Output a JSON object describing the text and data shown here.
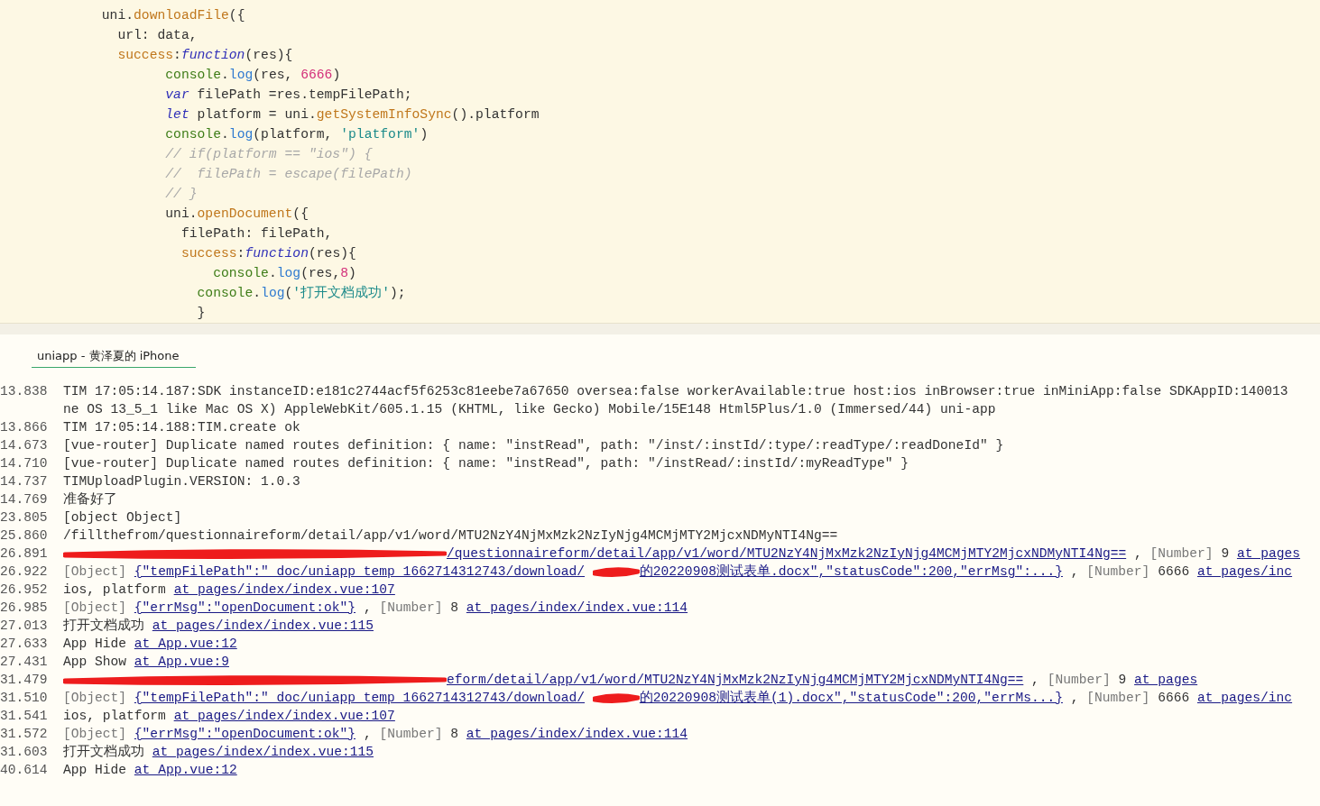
{
  "editor": {
    "lines": [
      [
        {
          "kind": "plain",
          "text": "            uni."
        },
        {
          "kind": "method",
          "text": "downloadFile"
        },
        {
          "kind": "plain",
          "text": "({"
        }
      ],
      [
        {
          "kind": "plain",
          "text": "              url: data,"
        }
      ],
      [
        {
          "kind": "method",
          "text": "              success"
        },
        {
          "kind": "plain",
          "text": ":"
        },
        {
          "kind": "keyword",
          "text": "function"
        },
        {
          "kind": "plain",
          "text": "(res){"
        }
      ],
      [
        {
          "kind": "console",
          "text": "                    console"
        },
        {
          "kind": "plain",
          "text": "."
        },
        {
          "kind": "log",
          "text": "log"
        },
        {
          "kind": "plain",
          "text": "(res, "
        },
        {
          "kind": "number",
          "text": "6666"
        },
        {
          "kind": "plain",
          "text": ")"
        }
      ],
      [
        {
          "kind": "keyword",
          "text": "                    var"
        },
        {
          "kind": "plain",
          "text": " filePath =res.tempFilePath;"
        }
      ],
      [
        {
          "kind": "keyword",
          "text": "                    let"
        },
        {
          "kind": "plain",
          "text": " platform = uni."
        },
        {
          "kind": "method",
          "text": "getSystemInfoSync"
        },
        {
          "kind": "plain",
          "text": "().platform"
        }
      ],
      [
        {
          "kind": "console",
          "text": "                    console"
        },
        {
          "kind": "plain",
          "text": "."
        },
        {
          "kind": "log",
          "text": "log"
        },
        {
          "kind": "plain",
          "text": "(platform, "
        },
        {
          "kind": "string",
          "text": "'platform'"
        },
        {
          "kind": "plain",
          "text": ")"
        }
      ],
      [
        {
          "kind": "comment",
          "text": "                    // if(platform == \"ios\") {"
        }
      ],
      [
        {
          "kind": "comment",
          "text": "                    //  filePath = escape(filePath)"
        }
      ],
      [
        {
          "kind": "comment",
          "text": "                    // }"
        }
      ],
      [
        {
          "kind": "plain",
          "text": "                    uni."
        },
        {
          "kind": "method",
          "text": "openDocument"
        },
        {
          "kind": "plain",
          "text": "({"
        }
      ],
      [
        {
          "kind": "plain",
          "text": "                      filePath: filePath,"
        }
      ],
      [
        {
          "kind": "method",
          "text": "                      success"
        },
        {
          "kind": "plain",
          "text": ":"
        },
        {
          "kind": "keyword",
          "text": "function"
        },
        {
          "kind": "plain",
          "text": "(res){"
        }
      ],
      [
        {
          "kind": "console",
          "text": "                          console"
        },
        {
          "kind": "plain",
          "text": "."
        },
        {
          "kind": "log",
          "text": "log"
        },
        {
          "kind": "plain",
          "text": "(res,"
        },
        {
          "kind": "number",
          "text": "8"
        },
        {
          "kind": "plain",
          "text": ")"
        }
      ],
      [
        {
          "kind": "console",
          "text": "                        console"
        },
        {
          "kind": "plain",
          "text": "."
        },
        {
          "kind": "log",
          "text": "log"
        },
        {
          "kind": "plain",
          "text": "("
        },
        {
          "kind": "string",
          "text": "'打开文档成功'"
        },
        {
          "kind": "plain",
          "text": ");"
        }
      ],
      [
        {
          "kind": "plain",
          "text": "                        }"
        }
      ]
    ]
  },
  "console": {
    "tab": {
      "label": "uniapp - 黄泽夏的 iPhone",
      "selected": true
    },
    "lines": [
      {
        "time": "13.838",
        "parts": [
          {
            "kind": "text",
            "text": "TIM 17:05:14.187:SDK instanceID:e181c2744acf5f6253c81eebe7a67650 oversea:false workerAvailable:true host:ios inBrowser:true inMiniApp:false SDKAppID:140013"
          }
        ]
      },
      {
        "parts": [
          {
            "kind": "text",
            "text": "ne OS 13_5_1 like Mac OS X) AppleWebKit/605.1.15 (KHTML, like Gecko) Mobile/15E148 Html5Plus/1.0 (Immersed/44) uni-app"
          }
        ]
      },
      {
        "time": "13.866",
        "parts": [
          {
            "kind": "text",
            "text": "TIM 17:05:14.188:TIM.create ok"
          }
        ]
      },
      {
        "time": "14.673",
        "parts": [
          {
            "kind": "text",
            "text": "[vue-router] Duplicate named routes definition: { name: \"instRead\", path: \"/inst/:instId/:type/:readType/:readDoneId\" }"
          }
        ]
      },
      {
        "time": "14.710",
        "parts": [
          {
            "kind": "text",
            "text": "[vue-router] Duplicate named routes definition: { name: \"instRead\", path: \"/instRead/:instId/:myReadType\" }"
          }
        ]
      },
      {
        "time": "14.737",
        "parts": [
          {
            "kind": "text",
            "text": "TIMUploadPlugin.VERSION: 1.0.3"
          }
        ]
      },
      {
        "time": "14.769",
        "parts": [
          {
            "kind": "text",
            "text": "准备好了"
          }
        ]
      },
      {
        "time": "23.805",
        "parts": [
          {
            "kind": "text",
            "text": "[object Object]"
          }
        ]
      },
      {
        "time": "25.860",
        "parts": [
          {
            "kind": "text",
            "text": "/fillthefrom/questionnaireform/detail/app/v1/word/MTU2NzY4NjMxMzk2NzIyNjg4MCMjMTY2MjcxNDMyNTI4Ng=="
          }
        ]
      },
      {
        "time": "26.891",
        "parts": [
          {
            "kind": "scrawl"
          },
          {
            "kind": "link",
            "text": "/questionnaireform/detail/app/v1/word/MTU2NzY4NjMxMzk2NzIyNjg4MCMjMTY2MjcxNDMyNTI4Ng=="
          },
          {
            "kind": "text",
            "text": ","
          },
          {
            "kind": "muted",
            "text": "[Number]"
          },
          {
            "kind": "text",
            "text": "9"
          },
          {
            "kind": "link",
            "text": "at pages"
          }
        ]
      },
      {
        "time": "26.922",
        "parts": [
          {
            "kind": "muted",
            "text": "[Object]"
          },
          {
            "kind": "link",
            "text": "{\"tempFilePath\":\"_doc/uniapp_temp_1662714312743/download/"
          },
          {
            "kind": "blot"
          },
          {
            "kind": "link",
            "text": "的20220908测试表单.docx\",\"statusCode\":200,\"errMsg\":...}"
          },
          {
            "kind": "text",
            "text": ","
          },
          {
            "kind": "muted",
            "text": "[Number]"
          },
          {
            "kind": "text",
            "text": "6666"
          },
          {
            "kind": "link",
            "text": "at pages/inc"
          }
        ]
      },
      {
        "time": "26.952",
        "parts": [
          {
            "kind": "text",
            "text": "ios, platform"
          },
          {
            "kind": "link",
            "text": "at pages/index/index.vue:107"
          }
        ]
      },
      {
        "time": "26.985",
        "parts": [
          {
            "kind": "muted",
            "text": "[Object]"
          },
          {
            "kind": "link",
            "text": "{\"errMsg\":\"openDocument:ok\"}"
          },
          {
            "kind": "text",
            "text": ","
          },
          {
            "kind": "muted",
            "text": "[Number]"
          },
          {
            "kind": "text",
            "text": "8"
          },
          {
            "kind": "link",
            "text": "at pages/index/index.vue:114"
          }
        ]
      },
      {
        "time": "27.013",
        "parts": [
          {
            "kind": "text",
            "text": "打开文档成功"
          },
          {
            "kind": "link",
            "text": "at pages/index/index.vue:115"
          }
        ]
      },
      {
        "time": "27.633",
        "parts": [
          {
            "kind": "text",
            "text": "App Hide"
          },
          {
            "kind": "link",
            "text": "at App.vue:12"
          }
        ]
      },
      {
        "time": "27.431",
        "parts": [
          {
            "kind": "text",
            "text": "App Show"
          },
          {
            "kind": "link",
            "text": "at App.vue:9"
          }
        ]
      },
      {
        "time": "31.479",
        "parts": [
          {
            "kind": "scrawl"
          },
          {
            "kind": "link",
            "text": "eform/detail/app/v1/word/MTU2NzY4NjMxMzk2NzIyNjg4MCMjMTY2MjcxNDMyNTI4Ng=="
          },
          {
            "kind": "text",
            "text": ","
          },
          {
            "kind": "muted",
            "text": "[Number]"
          },
          {
            "kind": "text",
            "text": "9"
          },
          {
            "kind": "link",
            "text": "at pages"
          }
        ]
      },
      {
        "time": "31.510",
        "parts": [
          {
            "kind": "muted",
            "text": "[Object]"
          },
          {
            "kind": "link",
            "text": "{\"tempFilePath\":\"_doc/uniapp_temp_1662714312743/download/"
          },
          {
            "kind": "blot"
          },
          {
            "kind": "link",
            "text": "的20220908测试表单(1).docx\",\"statusCode\":200,\"errMs...}"
          },
          {
            "kind": "text",
            "text": ","
          },
          {
            "kind": "muted",
            "text": "[Number]"
          },
          {
            "kind": "text",
            "text": "6666"
          },
          {
            "kind": "link",
            "text": "at pages/inc"
          }
        ]
      },
      {
        "time": "31.541",
        "parts": [
          {
            "kind": "text",
            "text": "ios, platform"
          },
          {
            "kind": "link",
            "text": "at pages/index/index.vue:107"
          }
        ]
      },
      {
        "time": "31.572",
        "parts": [
          {
            "kind": "muted",
            "text": "[Object]"
          },
          {
            "kind": "link",
            "text": "{\"errMsg\":\"openDocument:ok\"}"
          },
          {
            "kind": "text",
            "text": ","
          },
          {
            "kind": "muted",
            "text": "[Number]"
          },
          {
            "kind": "text",
            "text": "8"
          },
          {
            "kind": "link",
            "text": "at pages/index/index.vue:114"
          }
        ]
      },
      {
        "time": "31.603",
        "parts": [
          {
            "kind": "text",
            "text": "打开文档成功"
          },
          {
            "kind": "link",
            "text": "at pages/index/index.vue:115"
          }
        ]
      },
      {
        "time": "40.614",
        "parts": [
          {
            "kind": "text",
            "text": "App Hide"
          },
          {
            "kind": "link",
            "text": "at App.vue:12"
          }
        ]
      }
    ]
  }
}
